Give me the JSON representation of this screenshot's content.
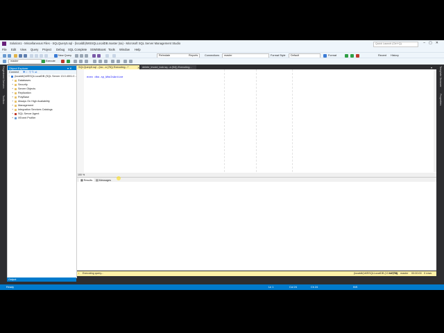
{
  "titlebar": {
    "title": "Solution1 - Miscellaneous Files - SQLQuery5.sql - (localdb)\\MSSQLLocalDB.master (sa) - Microsoft SQL Server Management Studio",
    "quick_launch_placeholder": "Quick Launch (Ctrl+Q)"
  },
  "menu": [
    "File",
    "Edit",
    "View",
    "Query",
    "Project",
    "Debug",
    "SQL Complete",
    "SSMSBoost",
    "Tools",
    "Window",
    "Help"
  ],
  "toolbar": {
    "new_query": "New Query",
    "database_combo": "Relmdate",
    "reports": "Reports",
    "connections": "Connections",
    "connection_db": "master",
    "format_style": "Format Style",
    "format_value": "Default",
    "format": "Format",
    "execute": "Execute",
    "recent": "Recent",
    "history": "History"
  },
  "side_left": {
    "server_explorer": "Registered Servers",
    "toolbox": "Toolbox"
  },
  "side_right": {
    "template_browser": "Template Browser",
    "properties": "Properties"
  },
  "object_explorer": {
    "title": "Object Explorer",
    "connect": "Connect",
    "server_node": "(localdb)\\MSSQLLocalDB (SQL Server 13.0.4001.0 - sa)",
    "nodes": [
      "Databases",
      "Security",
      "Server Objects",
      "Replication",
      "PolyBase",
      "Always On High Availability",
      "Management",
      "Integration Services Catalogs",
      "SQL Server Agent",
      "XEvent Profiler"
    ]
  },
  "editor": {
    "tabs": [
      {
        "label": "SQLQuery5.sql - (loc...a (76)) Executing...*",
        "active": true
      },
      {
        "label": "delete_invoid_lock.sq...a (54)) Executing...",
        "active": false
      }
    ],
    "code": "exec dbo.sp_WhoIsActive",
    "zoom": "100 %"
  },
  "results": {
    "tabs": [
      "Results",
      "Messages"
    ],
    "status": "Executing query...",
    "server": "(localdb)\\MSSQLLocalDB (13.0 RTM)",
    "user": "sa (76)",
    "db": "master",
    "time": "00:00:00",
    "rows": "0 rows"
  },
  "output_label": "Output",
  "statusbar": {
    "ready": "Ready",
    "ln": "Ln 1",
    "col": "Col 24",
    "ch": "Ch 24",
    "ins": "INS"
  },
  "colors": {
    "accent": "#007acc",
    "frame": "#2d2d30",
    "chrome": "#eef5fb",
    "executing": "#fff1a8"
  }
}
